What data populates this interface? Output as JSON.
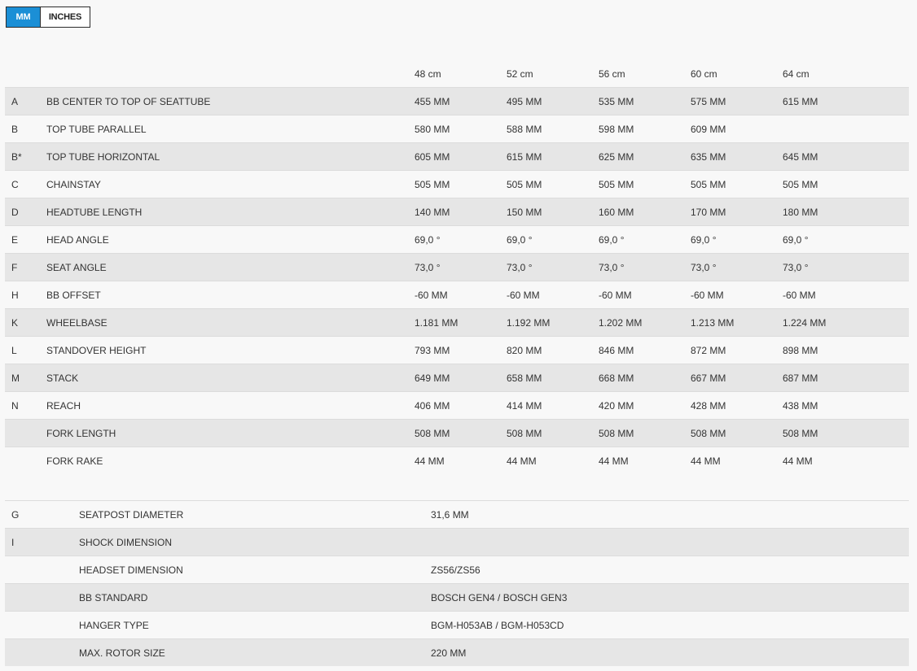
{
  "unit_toggle": {
    "mm_label": "MM",
    "inches_label": "INCHES",
    "selected": "MM",
    "active_color": "#1b8fd6"
  },
  "sizes": [
    "48 cm",
    "52 cm",
    "56 cm",
    "60 cm",
    "64 cm"
  ],
  "geometry": [
    {
      "letter": "A",
      "name": "BB CENTER TO TOP OF SEATTUBE",
      "values": [
        "455 MM",
        "495 MM",
        "535 MM",
        "575 MM",
        "615 MM"
      ]
    },
    {
      "letter": "B",
      "name": "TOP TUBE PARALLEL",
      "values": [
        "580 MM",
        "588 MM",
        "598 MM",
        "609 MM",
        ""
      ]
    },
    {
      "letter": "B*",
      "name": "TOP TUBE HORIZONTAL",
      "values": [
        "605 MM",
        "615 MM",
        "625 MM",
        "635 MM",
        "645 MM"
      ]
    },
    {
      "letter": "C",
      "name": "CHAINSTAY",
      "values": [
        "505 MM",
        "505 MM",
        "505 MM",
        "505 MM",
        "505 MM"
      ]
    },
    {
      "letter": "D",
      "name": "HEADTUBE LENGTH",
      "values": [
        "140 MM",
        "150 MM",
        "160 MM",
        "170 MM",
        "180 MM"
      ]
    },
    {
      "letter": "E",
      "name": "HEAD ANGLE",
      "values": [
        "69,0 °",
        "69,0 °",
        "69,0 °",
        "69,0 °",
        "69,0 °"
      ]
    },
    {
      "letter": "F",
      "name": "SEAT ANGLE",
      "values": [
        "73,0 °",
        "73,0 °",
        "73,0 °",
        "73,0 °",
        "73,0 °"
      ]
    },
    {
      "letter": "H",
      "name": "BB OFFSET",
      "values": [
        "-60 MM",
        "-60 MM",
        "-60 MM",
        "-60 MM",
        "-60 MM"
      ]
    },
    {
      "letter": "K",
      "name": "WHEELBASE",
      "values": [
        "1.181 MM",
        "1.192 MM",
        "1.202 MM",
        "1.213 MM",
        "1.224 MM"
      ]
    },
    {
      "letter": "L",
      "name": "STANDOVER HEIGHT",
      "values": [
        "793 MM",
        "820 MM",
        "846 MM",
        "872 MM",
        "898 MM"
      ]
    },
    {
      "letter": "M",
      "name": "STACK",
      "values": [
        "649 MM",
        "658 MM",
        "668 MM",
        "667 MM",
        "687 MM"
      ]
    },
    {
      "letter": "N",
      "name": "REACH",
      "values": [
        "406 MM",
        "414 MM",
        "420 MM",
        "428 MM",
        "438 MM"
      ]
    },
    {
      "letter": "",
      "name": "FORK LENGTH",
      "values": [
        "508 MM",
        "508 MM",
        "508 MM",
        "508 MM",
        "508 MM"
      ]
    },
    {
      "letter": "",
      "name": "FORK RAKE",
      "values": [
        "44 MM",
        "44 MM",
        "44 MM",
        "44 MM",
        "44 MM"
      ]
    }
  ],
  "specs": [
    {
      "letter": "G",
      "name": "SEATPOST DIAMETER",
      "value": "31,6 MM"
    },
    {
      "letter": "I",
      "name": "SHOCK DIMENSION",
      "value": ""
    },
    {
      "letter": "",
      "name": "HEADSET DIMENSION",
      "value": "ZS56/ZS56"
    },
    {
      "letter": "",
      "name": "BB STANDARD",
      "value": "BOSCH GEN4 / BOSCH GEN3"
    },
    {
      "letter": "",
      "name": "HANGER TYPE",
      "value": "BGM-H053AB / BGM-H053CD"
    },
    {
      "letter": "",
      "name": "MAX. ROTOR SIZE",
      "value": "220 MM"
    }
  ]
}
